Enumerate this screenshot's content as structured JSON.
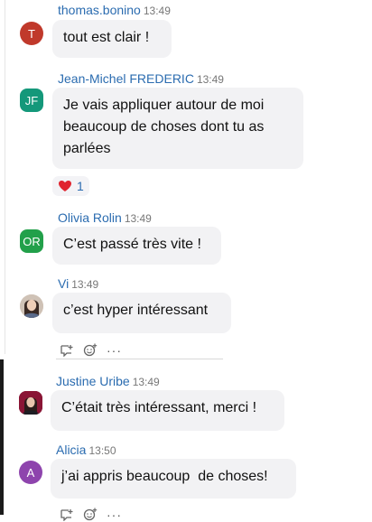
{
  "messages": [
    {
      "author": "thomas.bonino",
      "time": "13:49",
      "avatar": "T",
      "avatar_color": "#c0392b",
      "text": "tout est clair !"
    },
    {
      "author": "Jean-Michel FREDERIC",
      "time": "13:49",
      "avatar": "JF",
      "avatar_color": "#14987a",
      "lines": [
        "Je vais appliquer autour de moi",
        "beaucoup de choses dont tu as",
        "parlées"
      ],
      "reaction": {
        "emoji": "heart-icon",
        "count": "1"
      }
    },
    {
      "author": "Olivia Rolin",
      "time": "13:49",
      "avatar": "OR",
      "avatar_color": "#22a04a",
      "text": "C’est passé très vite !"
    },
    {
      "author": "Vi",
      "time": "13:49",
      "avatar": "photo",
      "text": "c’est hyper intéressant"
    },
    {
      "author": "Justine Uribe",
      "time": "13:49",
      "avatar": "photo",
      "text": "C’était très intéressant, merci !"
    },
    {
      "author": "Alicia",
      "time": "13:50",
      "avatar": "A",
      "avatar_color": "#8e44ad",
      "text": "j’ai appris beaucoup  de choses!"
    }
  ],
  "actions": {
    "more": "···"
  }
}
